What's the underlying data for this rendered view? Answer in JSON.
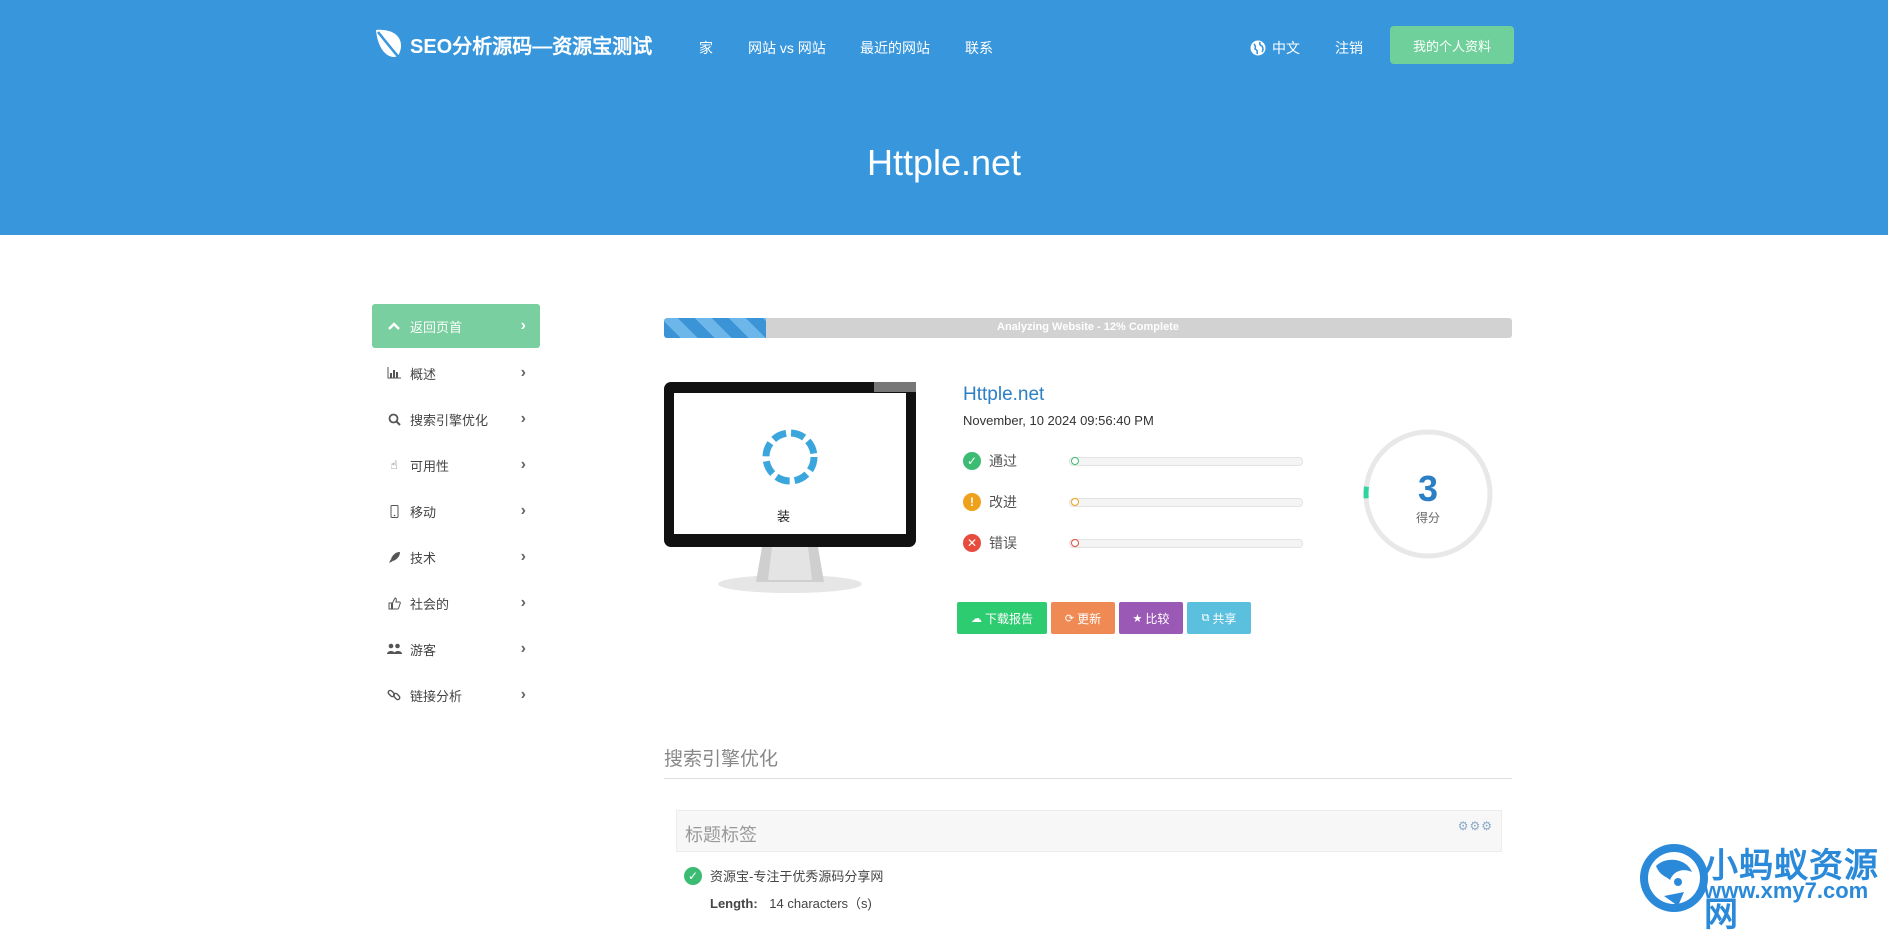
{
  "header": {
    "brand": "SEO分析源码—资源宝测试",
    "nav": [
      "家",
      "网站 vs 网站",
      "最近的网站",
      "联系"
    ],
    "language": "中文",
    "logout": "注销",
    "profile_button": "我的个人资料",
    "hero_title": "Httple.net"
  },
  "sidebar": {
    "items": [
      {
        "label": "返回页首",
        "icon": "chevron-up-icon"
      },
      {
        "label": "概述",
        "icon": "bar-chart-icon"
      },
      {
        "label": "搜索引擎优化",
        "icon": "search-icon"
      },
      {
        "label": "可用性",
        "icon": "hand-pointer-icon"
      },
      {
        "label": "移动",
        "icon": "mobile-icon"
      },
      {
        "label": "技术",
        "icon": "rocket-icon"
      },
      {
        "label": "社会的",
        "icon": "thumbs-up-icon"
      },
      {
        "label": "游客",
        "icon": "users-icon"
      },
      {
        "label": "链接分析",
        "icon": "link-icon"
      }
    ]
  },
  "progress": {
    "text": "Analyzing Website - 12% Complete",
    "percent": 12
  },
  "preview": {
    "loading_text": "装载..."
  },
  "site": {
    "name": "Httple.net",
    "date": "November, 10 2024 09:56:40 PM"
  },
  "stats": [
    {
      "label": "通过",
      "glyph": "✓",
      "color": "#3cbc72",
      "value": 0
    },
    {
      "label": "改进",
      "glyph": "!",
      "color": "#f0a11c",
      "value": 0
    },
    {
      "label": "错误",
      "glyph": "✕",
      "color": "#e74c3c",
      "value": 0
    }
  ],
  "score": {
    "value": "3",
    "label": "得分",
    "percent": 3
  },
  "actions": [
    {
      "label": "下载报告",
      "icon": "cloud-download-icon",
      "glyph": "☁",
      "color": "#2ecc71"
    },
    {
      "label": "更新",
      "icon": "refresh-icon",
      "glyph": "⟳",
      "color": "#f08a54"
    },
    {
      "label": "比较",
      "icon": "star-icon",
      "glyph": "★",
      "color": "#9b59b6"
    },
    {
      "label": "共享",
      "icon": "share-icon",
      "glyph": "⧉",
      "color": "#5bc0de"
    }
  ],
  "seo_section": {
    "title": "搜索引擎优化",
    "panel_title": "标题标签",
    "title_tag": "资源宝-专注于优秀源码分享网",
    "length_label": "Length:",
    "length_value": "14 characters（s)"
  },
  "watermark": {
    "line1": "小蚂蚁资源网",
    "line2": "www.xmy7.com"
  }
}
